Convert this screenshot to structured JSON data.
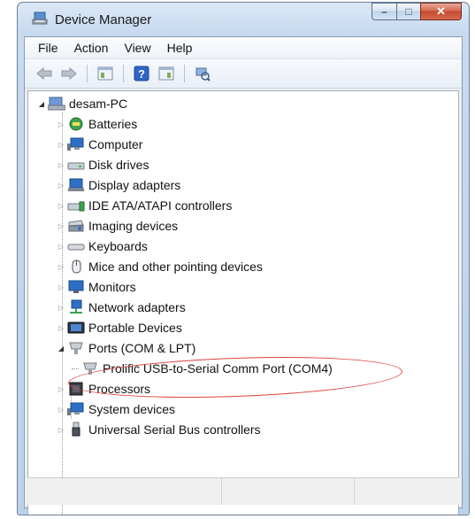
{
  "window": {
    "title": "Device Manager",
    "controls": {
      "minimize": "–",
      "maximize": "□",
      "close": "✕"
    }
  },
  "menu": [
    "File",
    "Action",
    "View",
    "Help"
  ],
  "toolbar": [
    "back-icon",
    "forward-icon",
    "properties-icon",
    "help-icon",
    "show-hidden-icon",
    "scan-hardware-icon"
  ],
  "tree": {
    "root": "desam-PC",
    "items": [
      {
        "label": "Batteries",
        "icon": "battery-icon"
      },
      {
        "label": "Computer",
        "icon": "computer-icon"
      },
      {
        "label": "Disk drives",
        "icon": "disk-drive-icon"
      },
      {
        "label": "Display adapters",
        "icon": "display-adapter-icon"
      },
      {
        "label": "IDE ATA/ATAPI controllers",
        "icon": "ide-controller-icon"
      },
      {
        "label": "Imaging devices",
        "icon": "imaging-device-icon"
      },
      {
        "label": "Keyboards",
        "icon": "keyboard-icon"
      },
      {
        "label": "Mice and other pointing devices",
        "icon": "mouse-icon"
      },
      {
        "label": "Monitors",
        "icon": "monitor-icon"
      },
      {
        "label": "Network adapters",
        "icon": "network-adapter-icon"
      },
      {
        "label": "Portable Devices",
        "icon": "portable-device-icon"
      },
      {
        "label": "Ports (COM & LPT)",
        "icon": "port-icon",
        "expanded": true
      },
      {
        "label": "Prolific USB-to-Serial Comm Port (COM4)",
        "icon": "port-icon",
        "child": true
      },
      {
        "label": "Processors",
        "icon": "processor-icon"
      },
      {
        "label": "System devices",
        "icon": "system-device-icon"
      },
      {
        "label": "Universal Serial Bus controllers",
        "icon": "usb-icon"
      }
    ]
  },
  "colors": {
    "highlight": "#e0413a",
    "titlebar": "#c7daf0"
  }
}
